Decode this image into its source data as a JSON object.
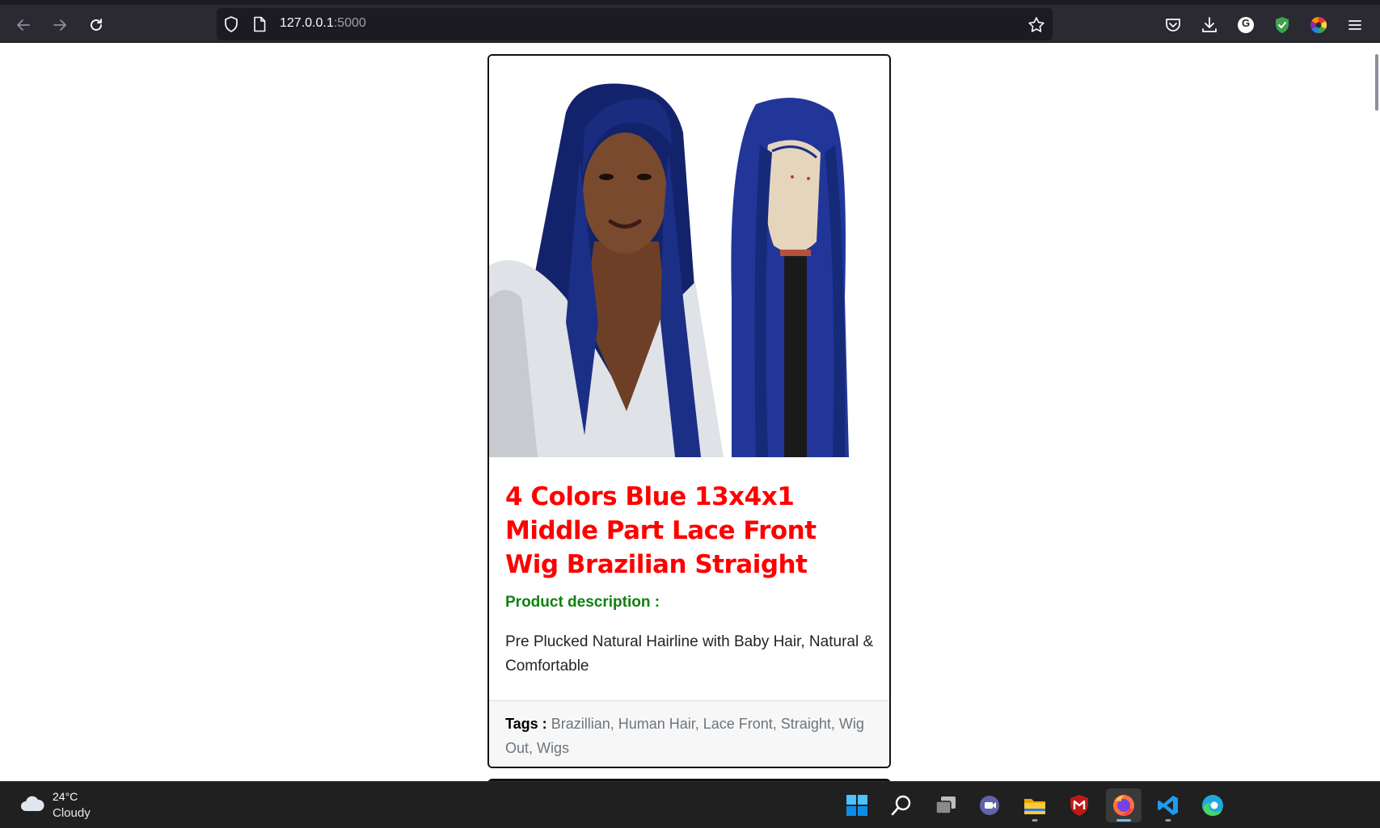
{
  "browser": {
    "url_host": "127.0.0.1",
    "url_port": ":5000",
    "profile_letter": "G"
  },
  "product": {
    "title": "4 Colors Blue 13x4x1 Middle Part Lace Front Wig Brazilian Straight",
    "description_heading": "Product description :",
    "description": "Pre Plucked Natural Hairline with Baby Hair, Natural & Comfortable",
    "tags_label": "Tags :",
    "tags": "Brazillian, Human Hair, Lace Front, Straight, Wig Out, Wigs"
  },
  "taskbar": {
    "weather_temp": "24°C",
    "weather_condition": "Cloudy",
    "apps": [
      "windows-start",
      "search",
      "task-view",
      "teams-chat",
      "file-explorer",
      "mcafee",
      "firefox",
      "vscode",
      "edge"
    ],
    "active_app": "firefox"
  },
  "colors": {
    "title": "#ff0000",
    "description_heading": "#118011",
    "tags_text": "#6c757d",
    "browser_chrome": "#2b2a33",
    "hair_blue": "#1c2f86"
  }
}
